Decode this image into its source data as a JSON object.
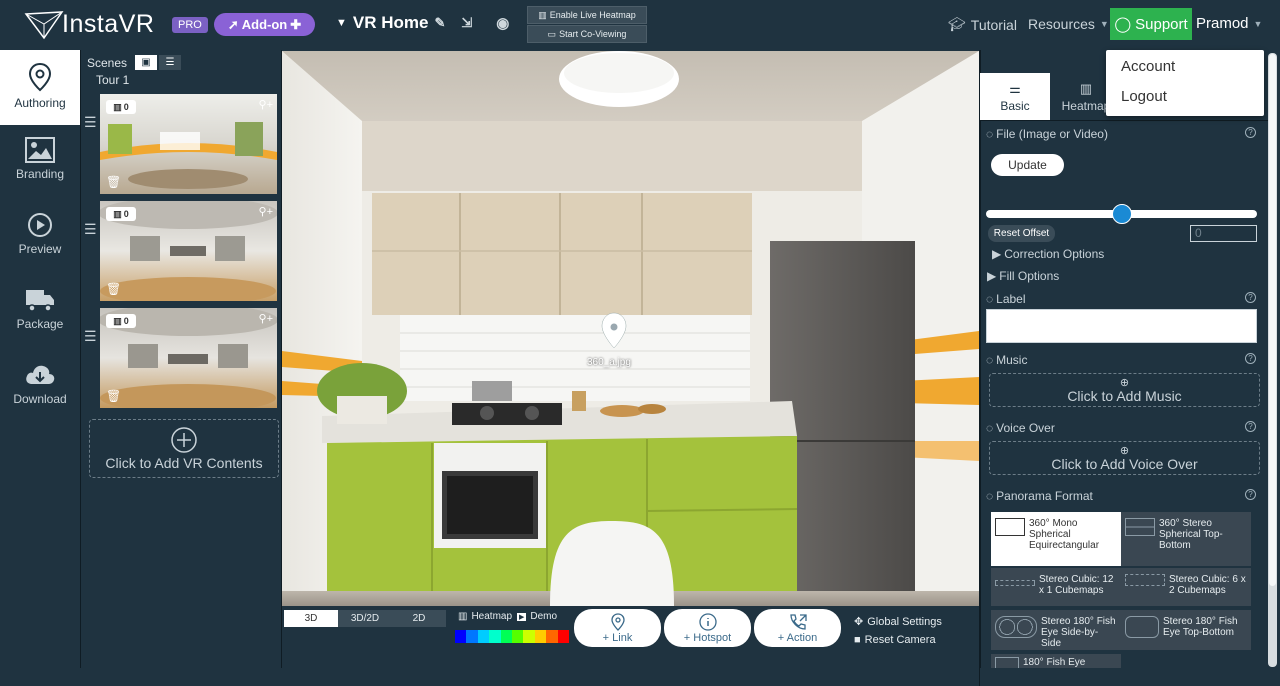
{
  "header": {
    "logo": "InstaVR",
    "pro_badge": "PRO",
    "addon_label": "Add-on",
    "project_title": "VR Home",
    "live_heatmap_label": "Enable Live Heatmap",
    "coviewing_label": "Start Co-Viewing",
    "tutorial_label": "Tutorial",
    "resources_label": "Resources",
    "support_label": "Support",
    "user_name": "Pramod"
  },
  "user_menu": {
    "items": [
      "Account",
      "Logout"
    ]
  },
  "sidebar": {
    "items": [
      {
        "label": "Authoring",
        "icon": "map-pin-icon",
        "active": true
      },
      {
        "label": "Branding",
        "icon": "image-icon",
        "active": false
      },
      {
        "label": "Preview",
        "icon": "play-icon",
        "active": false
      },
      {
        "label": "Package",
        "icon": "truck-icon",
        "active": false
      },
      {
        "label": "Download",
        "icon": "cloud-download-icon",
        "active": false
      }
    ]
  },
  "scenes": {
    "title": "Scenes",
    "tour_label": "Tour 1",
    "thumbnails": [
      {
        "count": "0"
      },
      {
        "count": "0"
      },
      {
        "count": "0"
      }
    ],
    "add_label": "Click to Add VR Contents"
  },
  "viewer": {
    "hotspot_label": "360_a.jpg"
  },
  "bottom_toolbar": {
    "modes": [
      "3D",
      "3D/2D",
      "2D"
    ],
    "active_mode": "3D",
    "heatmap_label": "Heatmap",
    "demo_label": "Demo",
    "heatmap_colors": [
      "#0000ff",
      "#0077ff",
      "#00ccff",
      "#00ffcc",
      "#00ff55",
      "#55ff00",
      "#ccff00",
      "#ffcc00",
      "#ff6600",
      "#ff0000"
    ],
    "link_label": "+ Link",
    "hotspot_label": "+ Hotspot",
    "action_label": "+ Action",
    "global_settings_label": "Global Settings",
    "reset_camera_label": "Reset Camera"
  },
  "right_panel": {
    "tabs": [
      {
        "label": "Basic",
        "active": true
      },
      {
        "label": "Heatmap",
        "active": false
      }
    ],
    "file_label": "File (Image or Video)",
    "update_label": "Update",
    "offset_slider_fraction": 0.5,
    "reset_offset_label": "Reset Offset",
    "offset_value": "0",
    "correction_label": "Correction Options",
    "fill_label": "Fill Options",
    "label_label": "Label",
    "label_value": "",
    "music_label": "Music",
    "add_music_label": "Click to Add Music",
    "voice_label": "Voice Over",
    "add_voice_label": "Click to Add Voice Over",
    "format_label": "Panorama Format",
    "formats": [
      {
        "label": "360° Mono Spherical Equirectangular",
        "selected": true
      },
      {
        "label": "360° Stereo Spherical Top-Bottom",
        "selected": false
      },
      {
        "label": "Stereo Cubic: 12 x 1 Cubemaps",
        "selected": false
      },
      {
        "label": "Stereo Cubic: 6 x 2 Cubemaps",
        "selected": false
      },
      {
        "label": "Stereo 180° Fish Eye Side-by-Side",
        "selected": false
      },
      {
        "label": "Stereo 180° Fish Eye Top-Bottom",
        "selected": false
      },
      {
        "label": "180° Fish Eye",
        "selected": false
      }
    ]
  }
}
